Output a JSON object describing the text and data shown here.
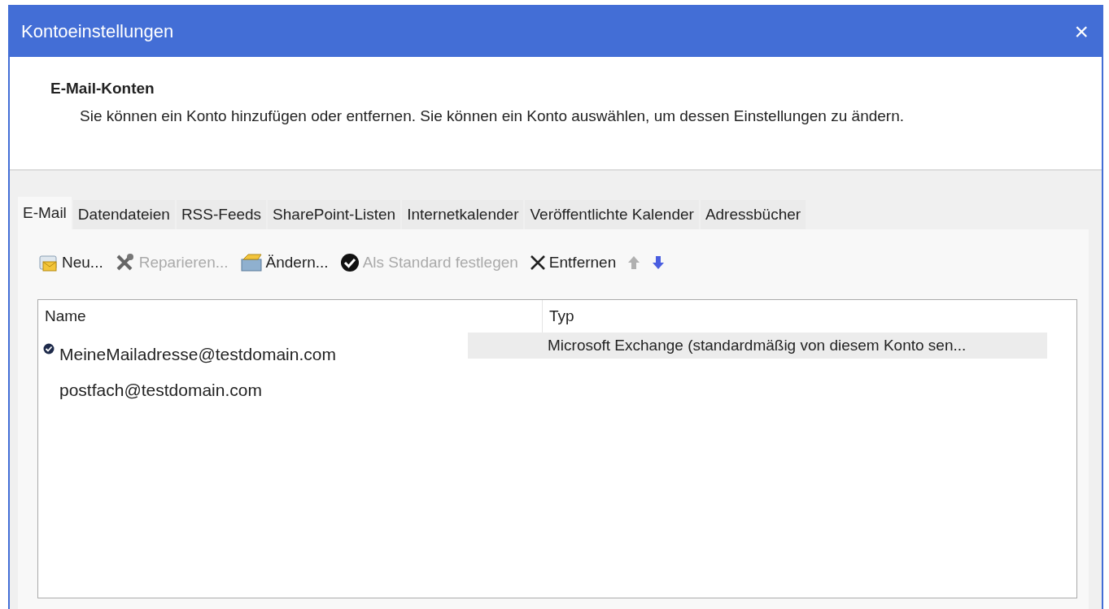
{
  "window": {
    "title": "Kontoeinstellungen",
    "close": "×"
  },
  "header": {
    "heading": "E-Mail-Konten",
    "description": "Sie können ein Konto hinzufügen oder entfernen. Sie können ein Konto auswählen, um dessen Einstellungen zu ändern."
  },
  "tabs": [
    {
      "label": "E-Mail",
      "selected": true
    },
    {
      "label": "Datendateien",
      "selected": false
    },
    {
      "label": "RSS-Feeds",
      "selected": false
    },
    {
      "label": "SharePoint-Listen",
      "selected": false
    },
    {
      "label": "Internetkalender",
      "selected": false
    },
    {
      "label": "Veröffentlichte Kalender",
      "selected": false
    },
    {
      "label": "Adressbücher",
      "selected": false
    }
  ],
  "toolbar": [
    {
      "kind": "new",
      "label": "Neu...",
      "disabled": false
    },
    {
      "kind": "repair",
      "label": "Reparieren...",
      "disabled": true
    },
    {
      "kind": "change",
      "label": "Ändern...",
      "disabled": false
    },
    {
      "kind": "default",
      "label": "Als Standard festlegen",
      "disabled": true
    },
    {
      "kind": "remove",
      "label": "Entfernen",
      "disabled": false
    },
    {
      "kind": "up",
      "disabled": true
    },
    {
      "kind": "down",
      "disabled": false
    }
  ],
  "table": {
    "columns": [
      "Name",
      "Typ"
    ],
    "rows": [
      {
        "name": "MeineMailadresse@testdomain.com",
        "type": "Microsoft Exchange (standardmäßig von diesem Konto sen...",
        "default": true,
        "selected": true
      },
      {
        "name": "postfach@testdomain.com",
        "default": false,
        "selected": false
      }
    ]
  }
}
